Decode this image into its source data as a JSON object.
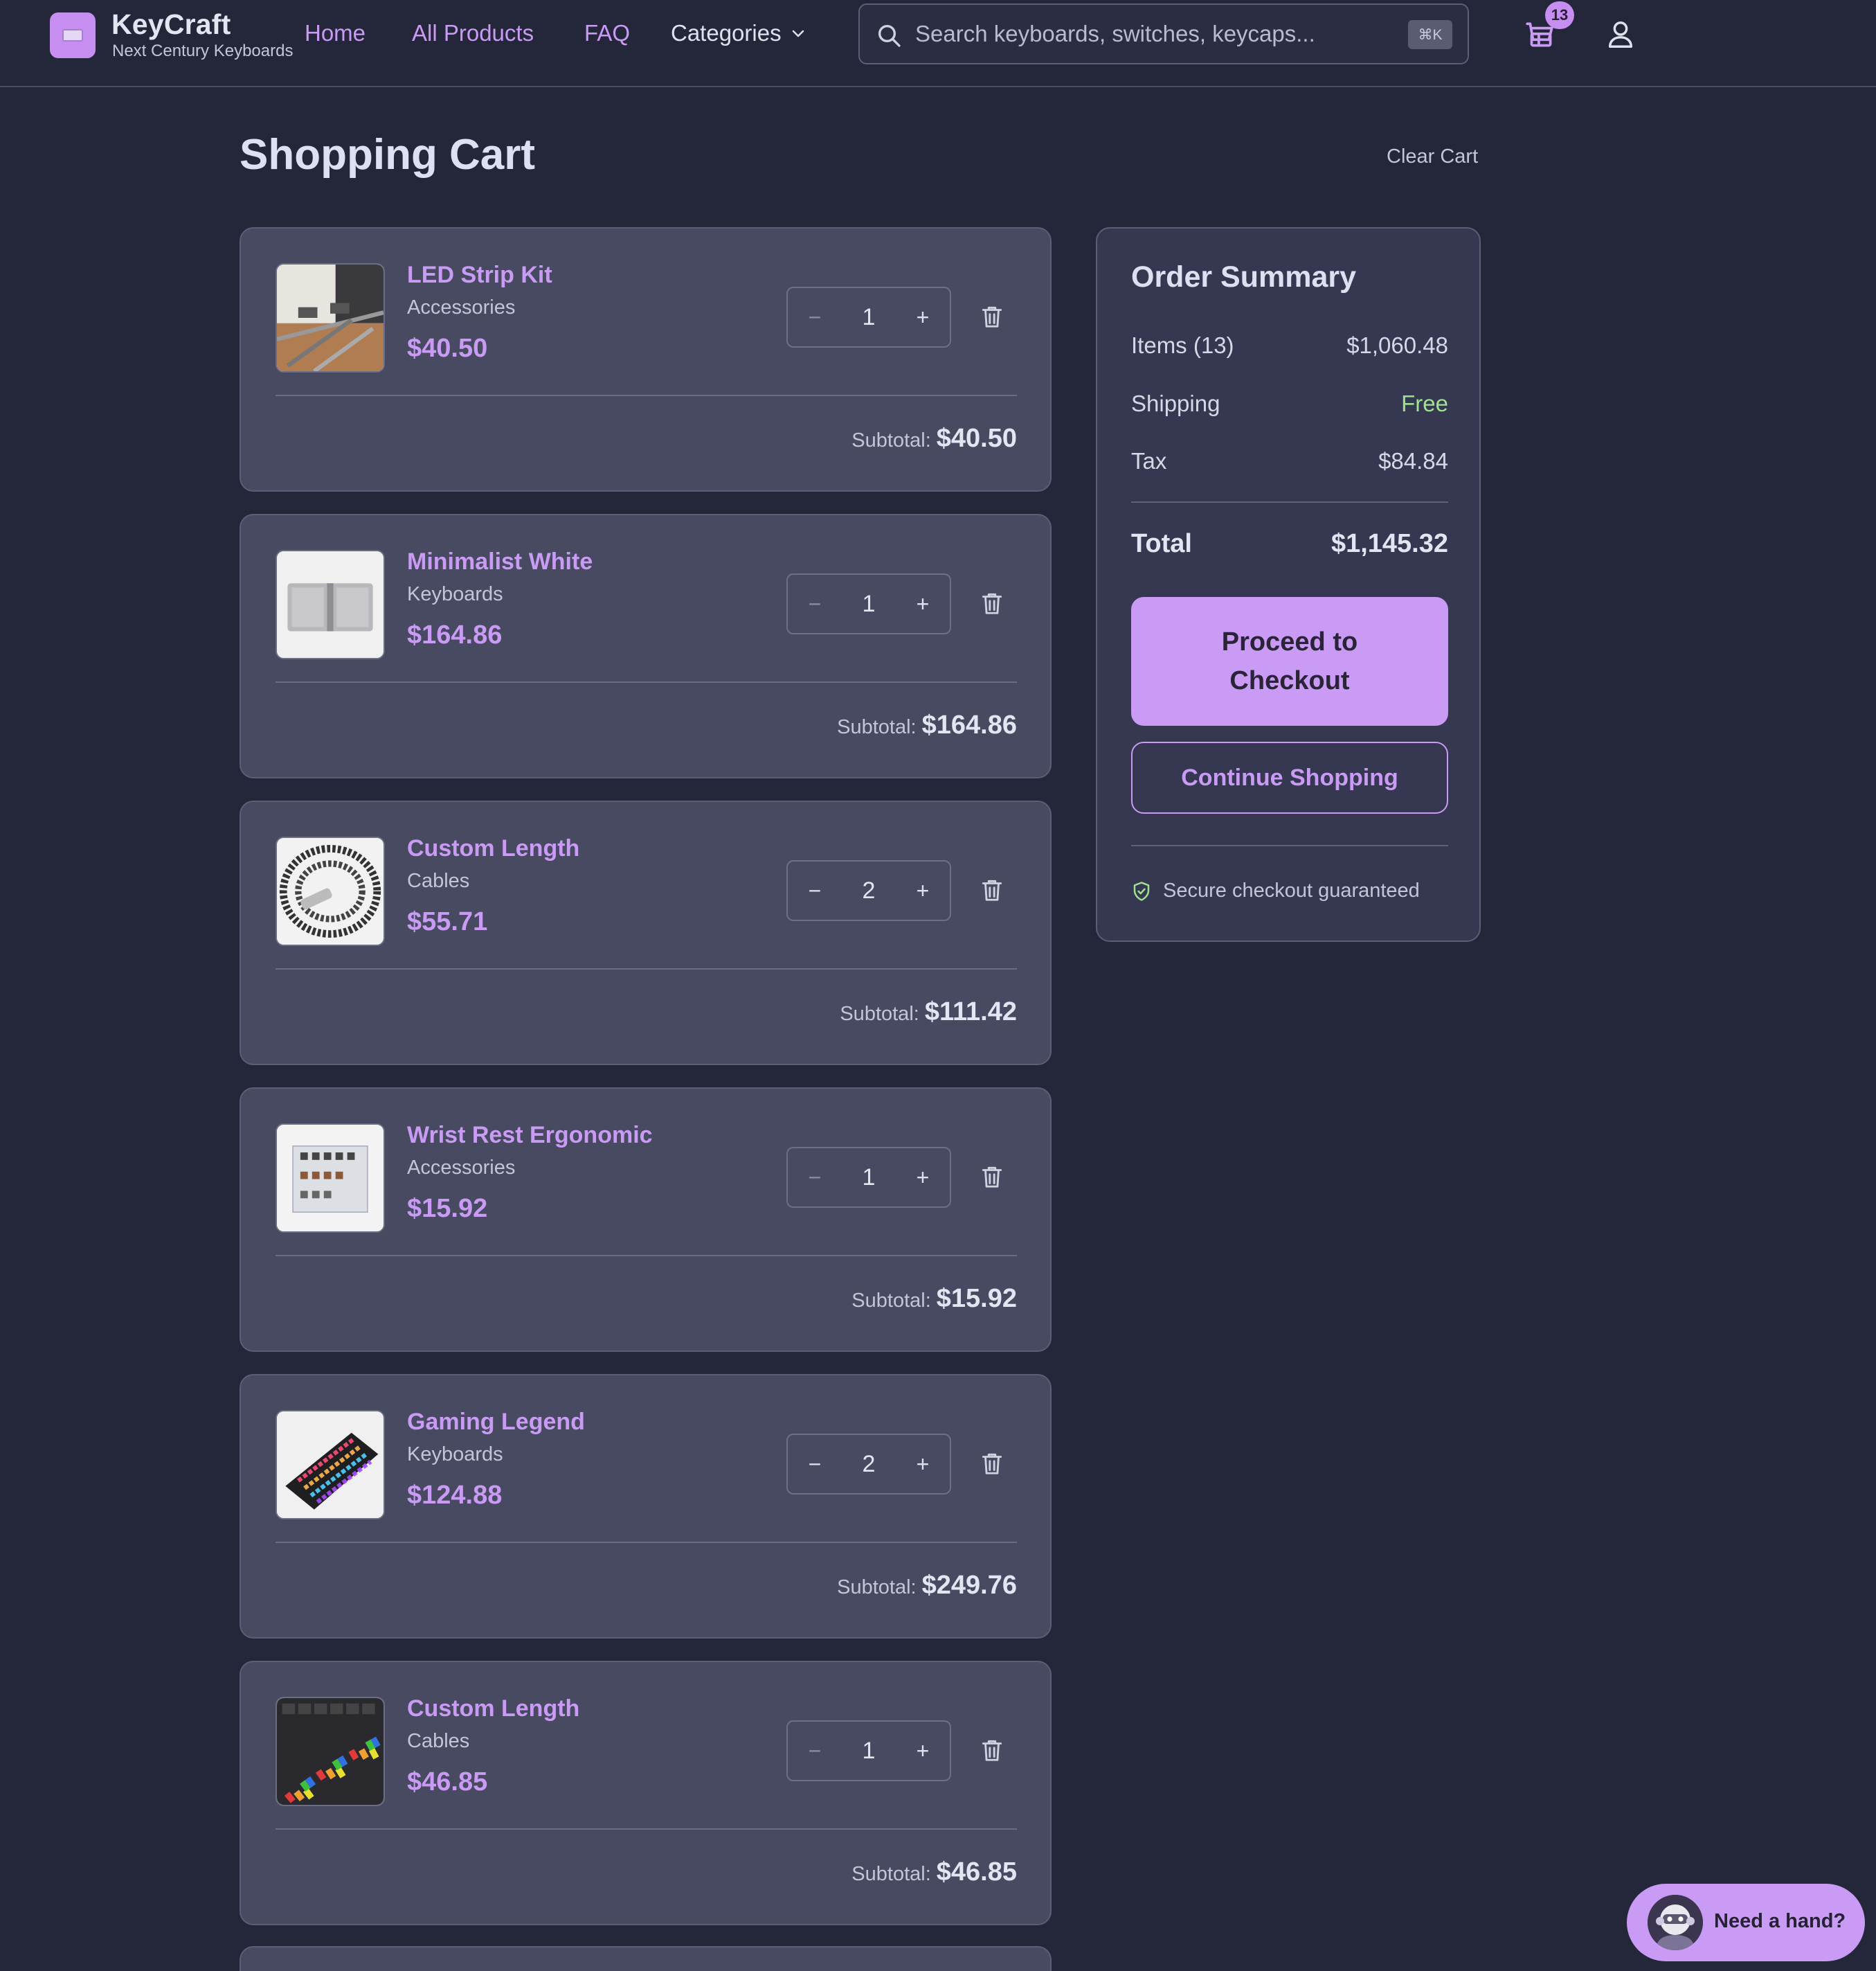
{
  "brand": {
    "name": "KeyCraft",
    "tagline": "Next Century Keyboards"
  },
  "nav": {
    "home": "Home",
    "all_products": "All Products",
    "faq": "FAQ",
    "categories": "Categories"
  },
  "search": {
    "placeholder": "Search keyboards, switches, keycaps...",
    "shortcut": "⌘K"
  },
  "cart_badge": "13",
  "page": {
    "title": "Shopping Cart",
    "clear_cart": "Clear Cart"
  },
  "items": [
    {
      "name": "LED Strip Kit",
      "category": "Accessories",
      "price": "$40.50",
      "qty": "1",
      "subtotal_label": "Subtotal:",
      "subtotal": "$40.50"
    },
    {
      "name": "Minimalist White",
      "category": "Keyboards",
      "price": "$164.86",
      "qty": "1",
      "subtotal_label": "Subtotal:",
      "subtotal": "$164.86"
    },
    {
      "name": "Custom Length",
      "category": "Cables",
      "price": "$55.71",
      "qty": "2",
      "subtotal_label": "Subtotal:",
      "subtotal": "$111.42"
    },
    {
      "name": "Wrist Rest Ergonomic",
      "category": "Accessories",
      "price": "$15.92",
      "qty": "1",
      "subtotal_label": "Subtotal:",
      "subtotal": "$15.92"
    },
    {
      "name": "Gaming Legend",
      "category": "Keyboards",
      "price": "$124.88",
      "qty": "2",
      "subtotal_label": "Subtotal:",
      "subtotal": "$249.76"
    },
    {
      "name": "Custom Length",
      "category": "Cables",
      "price": "$46.85",
      "qty": "1",
      "subtotal_label": "Subtotal:",
      "subtotal": "$46.85"
    }
  ],
  "summary": {
    "title": "Order Summary",
    "items_label": "Items (13)",
    "items_value": "$1,060.48",
    "shipping_label": "Shipping",
    "shipping_value": "Free",
    "tax_label": "Tax",
    "tax_value": "$84.84",
    "total_label": "Total",
    "total_value": "$1,145.32",
    "checkout": "Proceed to Checkout",
    "continue": "Continue Shopping",
    "secure": "Secure checkout guaranteed"
  },
  "help": {
    "label": "Need a hand?"
  },
  "colors": {
    "background": "#24263a",
    "card": "#484a61",
    "accent": "#c99bf4",
    "free": "#9ee28f"
  }
}
